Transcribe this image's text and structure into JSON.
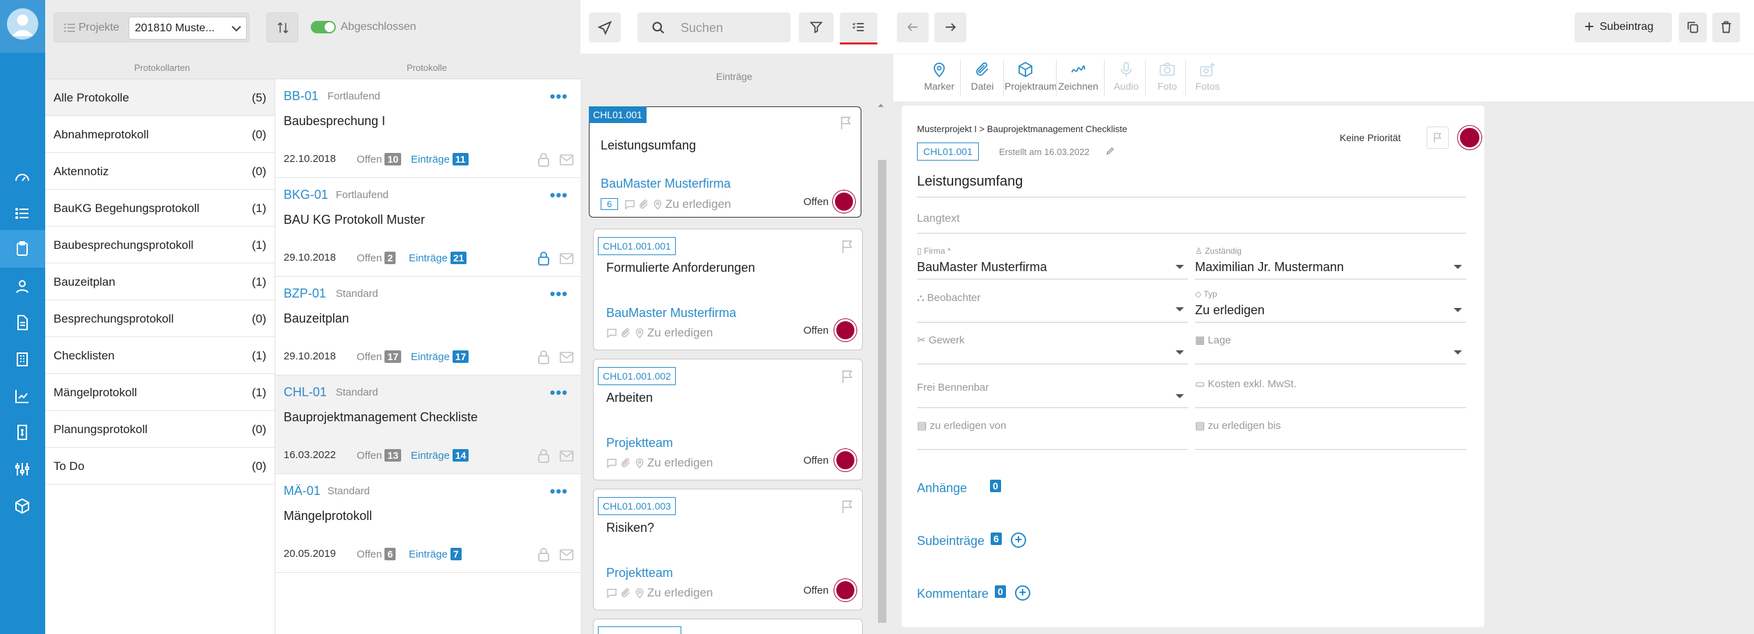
{
  "protocols_panel": {
    "projects_label": "Projekte",
    "project_value": "201810 Muste...",
    "completed_label": "Abgeschlossen",
    "col_types": "Protokollarten",
    "col_protocols": "Protokolle",
    "categories": [
      {
        "name": "Alle Protokolle",
        "count": "(5)"
      },
      {
        "name": "Abnahmeprotokoll",
        "count": "(0)"
      },
      {
        "name": "Aktennotiz",
        "count": "(0)"
      },
      {
        "name": "BauKG Begehungsprotokoll",
        "count": "(1)"
      },
      {
        "name": "Baubesprechungsprotokoll",
        "count": "(1)"
      },
      {
        "name": "Bauzeitplan",
        "count": "(1)"
      },
      {
        "name": "Besprechungsprotokoll",
        "count": "(0)"
      },
      {
        "name": "Checklisten",
        "count": "(1)"
      },
      {
        "name": "Mängelprotokoll",
        "count": "(1)"
      },
      {
        "name": "Planungsprotokoll",
        "count": "(0)"
      },
      {
        "name": "To Do",
        "count": "(0)"
      }
    ],
    "protocols": [
      {
        "code": "BB-01",
        "kind": "Fortlaufend",
        "title": "Baubesprechung I",
        "date": "22.10.2018",
        "open_label": "Offen",
        "open": "10",
        "entries_label": "Einträge",
        "entries": "11"
      },
      {
        "code": "BKG-01",
        "kind": "Fortlaufend",
        "title": "BAU KG Protokoll Muster",
        "date": "29.10.2018",
        "open_label": "Offen",
        "open": "2",
        "entries_label": "Einträge",
        "entries": "21"
      },
      {
        "code": "BZP-01",
        "kind": "Standard",
        "title": "Bauzeitplan",
        "date": "29.10.2018",
        "open_label": "Offen",
        "open": "17",
        "entries_label": "Einträge",
        "entries": "17"
      },
      {
        "code": "CHL-01",
        "kind": "Standard",
        "title": "Bauprojektmanagement Checkliste",
        "date": "16.03.2022",
        "open_label": "Offen",
        "open": "13",
        "entries_label": "Einträge",
        "entries": "14"
      },
      {
        "code": "MÄ-01",
        "kind": "Standard",
        "title": "Mängelprotokoll",
        "date": "20.05.2019",
        "open_label": "Offen",
        "open": "6",
        "entries_label": "Einträge",
        "entries": "7"
      }
    ],
    "more_dots": "•••"
  },
  "toolbar": {
    "search_placeholder": "Suchen",
    "subentry_label": "Subeintrag"
  },
  "entries": {
    "header": "Einträge",
    "cards": [
      {
        "code": "CHL01.001",
        "title": "Leistungsumfang",
        "firm": "BauMaster Musterfirma",
        "sub_count": "6",
        "status": "Zu erledigen",
        "state": "Offen"
      },
      {
        "code": "CHL01.001.001",
        "title": "Formulierte Anforderungen",
        "firm": "BauMaster Musterfirma",
        "status": "Zu erledigen",
        "state": "Offen"
      },
      {
        "code": "CHL01.001.002",
        "title": "Arbeiten",
        "firm": "Projektteam",
        "status": "Zu erledigen",
        "state": "Offen"
      },
      {
        "code": "CHL01.001.003",
        "title": "Risiken?",
        "firm": "Projektteam",
        "status": "Zu erledigen",
        "state": "Offen"
      }
    ]
  },
  "detail": {
    "tabs": [
      {
        "label": "Marker",
        "icon": "marker-icon",
        "enabled": true
      },
      {
        "label": "Datei",
        "icon": "paperclip-icon",
        "enabled": true
      },
      {
        "label": "Projektraum",
        "icon": "cube-icon",
        "enabled": true
      },
      {
        "label": "Zeichnen",
        "icon": "draw-icon",
        "enabled": true
      },
      {
        "label": "Audio",
        "icon": "microphone-icon",
        "enabled": false
      },
      {
        "label": "Foto",
        "icon": "camera-icon",
        "enabled": false
      },
      {
        "label": "Fotos",
        "icon": "photos-icon",
        "enabled": false
      }
    ],
    "breadcrumb": "Musterprojekt I > Bauprojektmanagement Checkliste",
    "code": "CHL01.001",
    "created": "Erstellt am 16.03.2022",
    "priority": "Keine Priorität",
    "title": "Leistungsumfang",
    "longtext_placeholder": "Langtext",
    "firm_label": "Firma *",
    "firm_value": "BauMaster Musterfirma",
    "responsible_label": "Zuständig",
    "responsible_value": "Maximilian Jr. Mustermann",
    "observer_label": "Beobachter",
    "type_label": "Typ",
    "type_value": "Zu erledigen",
    "trade_label": "Gewerk",
    "location_label": "Lage",
    "free_label": "Frei Bennenbar",
    "cost_label": "Kosten exkl. MwSt.",
    "from_label": "zu erledigen von",
    "until_label": "zu erledigen bis",
    "attachments_label": "Anhänge",
    "attachments_count": "0",
    "subentries_label": "Subeinträge",
    "subentries_count": "6",
    "comments_label": "Kommentare",
    "comments_count": "0"
  },
  "colors": {
    "accent": "#2b8cc9",
    "rail": "#1d8bcf",
    "status_dot": "#a3003a",
    "toggle": "#5cb85c"
  }
}
